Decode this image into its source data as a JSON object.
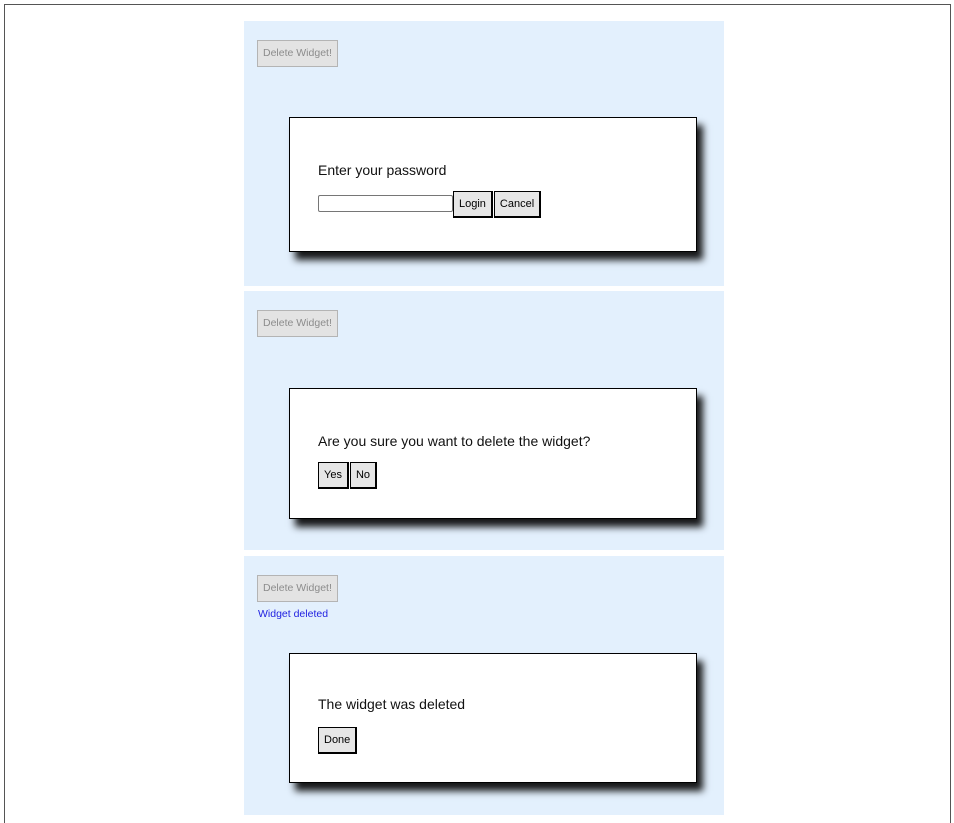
{
  "panels": [
    {
      "delete_button": "Delete Widget!",
      "status": "",
      "dialog": {
        "message": "Enter your password",
        "password_value": "",
        "buttons": [
          "Login",
          "Cancel"
        ]
      }
    },
    {
      "delete_button": "Delete Widget!",
      "status": "",
      "dialog": {
        "message": "Are you sure you want to delete the widget?",
        "buttons": [
          "Yes",
          "No"
        ]
      }
    },
    {
      "delete_button": "Delete Widget!",
      "status": "Widget deleted",
      "dialog": {
        "message": "The widget was deleted",
        "buttons": [
          "Done"
        ]
      }
    }
  ],
  "colors": {
    "panel_background": "#e3f0fd",
    "status_text": "#1e1ee0",
    "disabled_text": "#8c8c8c"
  }
}
